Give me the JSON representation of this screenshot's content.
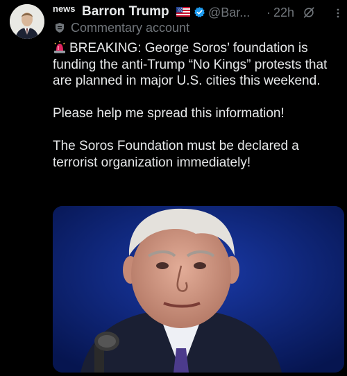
{
  "author": {
    "news_tag": "news",
    "display_name": "Barron Trump",
    "handle": "@Bar...",
    "separator": "·",
    "timestamp": "22h",
    "account_label": "Commentary account",
    "flag_icon": "us-flag-icon",
    "verified_icon": "verified-badge-icon",
    "verified_color": "#1d9bf0"
  },
  "tweet": {
    "lines": [
      "BREAKING: George Soros’ foundation is funding the anti-Trump “No Kings” protests that are planned in major U.S. cities this weekend.",
      "Please help me spread this information!",
      "The Soros Foundation must be declared a terrorist organization immediately!"
    ],
    "lead_icon": "siren-icon"
  },
  "media": {
    "kind": "photo",
    "subject": "elderly man at microphone, blue background"
  },
  "colors": {
    "background": "#000000",
    "text": "#e7e9ea",
    "secondary": "#71767b"
  }
}
